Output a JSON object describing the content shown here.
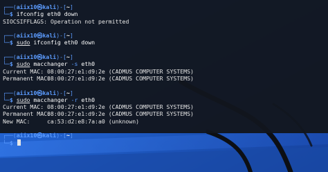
{
  "colors": {
    "prompt_blue": "#5c9cff",
    "prompt_dollar_green": "#33d17a",
    "terminal_bg": "#12161e",
    "desktop_blue": "#1f5cc6"
  },
  "prompt": {
    "user_host": "aiix10㉿kali",
    "open": "┌──(",
    "close": ")-[",
    "dir": "~",
    "end": "]",
    "corner": "└─",
    "dollar": "$"
  },
  "blocks": [
    {
      "command_parts": [
        {
          "text": "ifconfig eth0 down",
          "style": "cmd"
        }
      ],
      "output": [
        {
          "text": "SIOCSIFFLAGS: Operation not permitted"
        }
      ]
    },
    {
      "command_parts": [
        {
          "text": "sudo",
          "style": "sudo"
        },
        {
          "text": " ifconfig eth0 down",
          "style": "cmd"
        }
      ],
      "output": []
    },
    {
      "command_parts": [
        {
          "text": "sudo",
          "style": "sudo"
        },
        {
          "text": " macchanger ",
          "style": "cmd"
        },
        {
          "text": "-s",
          "style": "flag"
        },
        {
          "text": " eth0",
          "style": "cmd"
        }
      ],
      "output": [
        {
          "label": "Current MAC:",
          "value": "08:00:27:e1:d9:2e (CADMUS COMPUTER SYSTEMS)"
        },
        {
          "label": "Permanent MAC:",
          "value": "08:00:27:e1:d9:2e (CADMUS COMPUTER SYSTEMS)"
        }
      ]
    },
    {
      "command_parts": [
        {
          "text": "sudo",
          "style": "sudo"
        },
        {
          "text": " macchanger ",
          "style": "cmd"
        },
        {
          "text": "-r",
          "style": "flag"
        },
        {
          "text": " eth0",
          "style": "cmd"
        }
      ],
      "output": [
        {
          "label": "Current MAC:",
          "value": "08:00:27:e1:d9:2e (CADMUS COMPUTER SYSTEMS)"
        },
        {
          "label": "Permanent MAC:",
          "value": "08:00:27:e1:d9:2e (CADMUS COMPUTER SYSTEMS)"
        },
        {
          "label": "New MAC:",
          "value": "ca:53:d2:e8:7a:a0 (unknown)"
        }
      ]
    }
  ],
  "final_prompt": {
    "command": ""
  }
}
